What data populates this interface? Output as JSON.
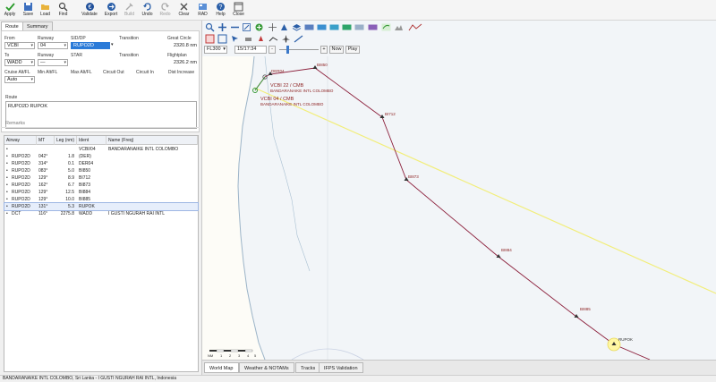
{
  "toolbar": {
    "apply": "Apply",
    "save": "Save",
    "load": "Load",
    "find": "Find",
    "validate": "Validate",
    "export": "Export",
    "build": "Build",
    "undo": "Undo",
    "redo": "Redo",
    "clear": "Clear",
    "rad": "RAD",
    "help": "Help",
    "close": "Close"
  },
  "tabs": {
    "route": "Route",
    "summary": "Summary"
  },
  "form": {
    "from_label": "From",
    "from": "VCBI",
    "runway_label": "Runway",
    "runway_from": "04",
    "sid_label": "SID/DP",
    "sid": "RUPO2D",
    "transition_label": "Transition",
    "great_circle_label": "Great Circle",
    "great_circle": "2320.8 nm",
    "to_label": "To",
    "to": "WADD",
    "runway_to_label": "Runway",
    "runway_to": "—",
    "star_label": "STAR",
    "transition2_label": "Transition",
    "flightplan_label": "Flightplan",
    "flightplan": "2326.2 nm",
    "cruise_label": "Cruise Alt/FL",
    "cruise": "Auto",
    "min_alt_label": "Min Alt/FL",
    "max_alt_label": "Max Alt/FL",
    "circuit_out_label": "Circuit Out",
    "circuit_in_label": "Circuit In",
    "dist_increase_label": "Dist Increase",
    "route_label": "Route",
    "route": "RUPO2D RUPOK",
    "remarks": "Remarks"
  },
  "grid": {
    "headers": [
      "Airway",
      "MT",
      "Leg (nm)",
      "Ident",
      "Name (Freq)"
    ],
    "rows": [
      {
        "airway": "",
        "mt": "",
        "leg": "",
        "ident": "VCBI/04",
        "name": "BANDARANAIKE INTL COLOMBO",
        "selected": false
      },
      {
        "airway": "RUPO2D",
        "mt": "042°",
        "leg": "1.8",
        "ident": "(DER)",
        "name": "",
        "selected": false
      },
      {
        "airway": "RUPO2D",
        "mt": "314°",
        "leg": "0.1",
        "ident": "DER04",
        "name": "",
        "selected": false
      },
      {
        "airway": "RUPO2D",
        "mt": "083°",
        "leg": "5.0",
        "ident": "BI850",
        "name": "",
        "selected": false
      },
      {
        "airway": "RUPO2D",
        "mt": "129°",
        "leg": "8.9",
        "ident": "BI712",
        "name": "",
        "selected": false
      },
      {
        "airway": "RUPO2D",
        "mt": "162°",
        "leg": "6.7",
        "ident": "BI873",
        "name": "",
        "selected": false
      },
      {
        "airway": "RUPO2D",
        "mt": "129°",
        "leg": "12.5",
        "ident": "BI884",
        "name": "",
        "selected": false
      },
      {
        "airway": "RUPO2D",
        "mt": "129°",
        "leg": "10.0",
        "ident": "BI885",
        "name": "",
        "selected": false
      },
      {
        "airway": "RUPO2D",
        "mt": "131°",
        "leg": "5.3",
        "ident": "RUPOK",
        "name": "",
        "selected": true
      },
      {
        "airway": "DCT",
        "mt": "116°",
        "leg": "2275.8",
        "ident": "WADD",
        "name": "I GUSTI NGURAH RAI INTL",
        "selected": false
      }
    ]
  },
  "map": {
    "fl": "FL300",
    "time": "15/17:34",
    "now": "Now",
    "play": "Play",
    "minus": "-",
    "plus": "+",
    "airport1_line1": "VCBI 22 / CMB",
    "airport1_line2": "BANDARANAIKE INTL COLOMBO",
    "airport2_line1": "VCBI 04 / CMB",
    "airport2_line2": "BANDARANAIKE INTL COLOMBO",
    "waypoints": [
      "DER04",
      "BI850",
      "BI712",
      "BI873",
      "BI884",
      "BI885",
      "RUPOK"
    ],
    "scale_labels": [
      "NM",
      "1",
      "2",
      "3",
      "4",
      "5"
    ],
    "tabs": [
      "World Map",
      "Weather & NOTAMs",
      "Tracks",
      "IFPS Validation"
    ],
    "route_color": "#8b1e3a",
    "yellow_color": "#f2ee7a"
  },
  "status": "BANDARANAIKE INTL COLOMBO, Sri Lanka - I GUSTI NGURAH RAI INTL, Indonesia"
}
